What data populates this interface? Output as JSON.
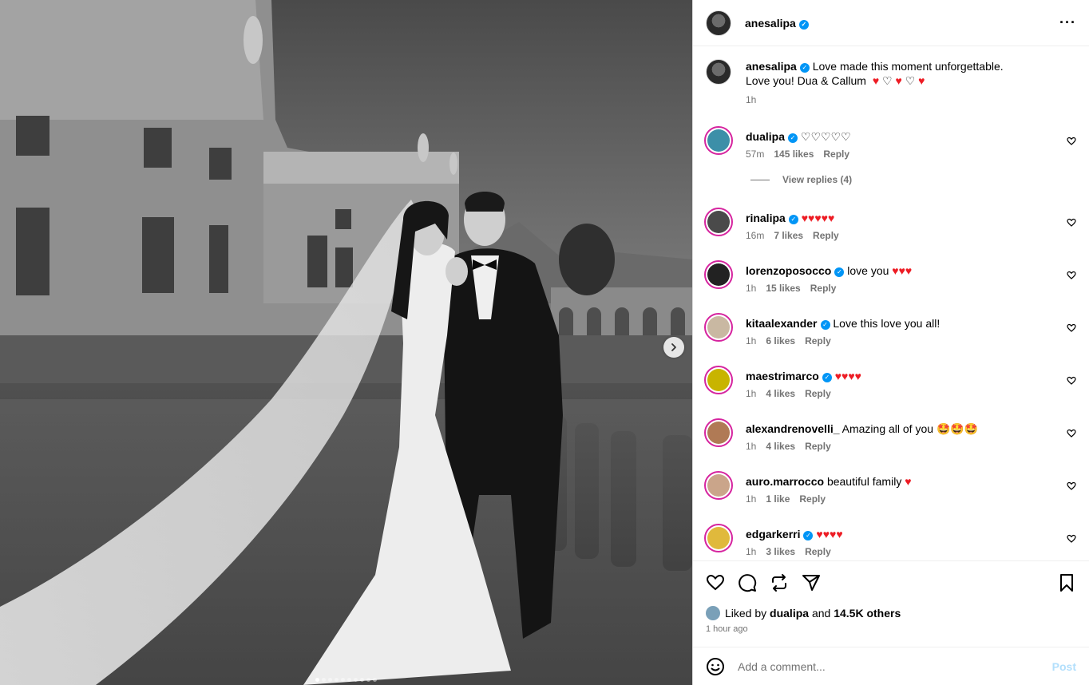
{
  "post": {
    "author": "anesalipa",
    "caption_line1": "Love made this moment unforgettable.",
    "caption_line2": "Love you! Dua & Callum",
    "caption_time": "1h",
    "slide_count": 10,
    "active_slide": 1
  },
  "comments": [
    {
      "user": "dualipa",
      "verified": true,
      "text": "",
      "hearts_red": 0,
      "hearts_white": 5,
      "time": "57m",
      "likes": "145 likes",
      "reply": "Reply",
      "avatar_color": "#3c8fa8"
    },
    {
      "user": "rinalipa",
      "verified": true,
      "text": "",
      "hearts_red": 5,
      "hearts_white": 0,
      "time": "16m",
      "likes": "7 likes",
      "reply": "Reply",
      "avatar_color": "#4a4a4a"
    },
    {
      "user": "lorenzoposocco",
      "verified": true,
      "text": "love you",
      "hearts_red": 3,
      "hearts_white": 0,
      "time": "1h",
      "likes": "15 likes",
      "reply": "Reply",
      "avatar_color": "#222222"
    },
    {
      "user": "kitaalexander",
      "verified": true,
      "text": "Love this love you all!",
      "hearts_red": 0,
      "hearts_white": 0,
      "time": "1h",
      "likes": "6 likes",
      "reply": "Reply",
      "avatar_color": "#c9b8a2"
    },
    {
      "user": "maestrimarco",
      "verified": true,
      "text": "",
      "hearts_red": 4,
      "hearts_white": 0,
      "time": "1h",
      "likes": "4 likes",
      "reply": "Reply",
      "avatar_color": "#c8b400"
    },
    {
      "user": "alexandrenovelli_",
      "verified": false,
      "text": "Amazing all of you",
      "emoji": "🤩🤩🤩",
      "hearts_red": 0,
      "hearts_white": 0,
      "time": "1h",
      "likes": "4 likes",
      "reply": "Reply",
      "avatar_color": "#b07a55"
    },
    {
      "user": "auro.marrocco",
      "verified": false,
      "text": "beautiful family",
      "hearts_red": 1,
      "hearts_white": 0,
      "time": "1h",
      "likes": "1 like",
      "reply": "Reply",
      "avatar_color": "#caa58a"
    },
    {
      "user": "edgarkerri",
      "verified": true,
      "text": "",
      "hearts_red": 4,
      "hearts_white": 0,
      "time": "1h",
      "likes": "3 likes",
      "reply": "Reply",
      "avatar_color": "#e0b93c"
    }
  ],
  "view_replies": "View replies (4)",
  "liked_by": {
    "prefix": "Liked by",
    "user": "dualipa",
    "and": "and",
    "others": "14.5K others"
  },
  "posted_ago": "1 hour ago",
  "add_comment": {
    "placeholder": "Add a comment...",
    "post_label": "Post"
  },
  "colors": {
    "heart_red": "#ed1c24",
    "verified": "#0095f6",
    "story_ring": "#d6249f",
    "post_button": "#b2dffc"
  },
  "icons": [
    "heart-icon",
    "comment-icon",
    "repost-icon",
    "share-icon",
    "bookmark-icon",
    "emoji-icon",
    "more-icon",
    "chevron-right-icon"
  ]
}
